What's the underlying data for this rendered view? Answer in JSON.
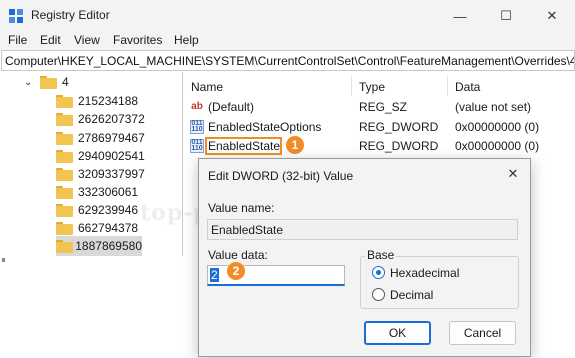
{
  "window": {
    "title": "Registry Editor",
    "minimize_glyph": "—",
    "maximize_glyph": "☐",
    "close_glyph": "✕"
  },
  "menu": [
    "File",
    "Edit",
    "View",
    "Favorites",
    "Help"
  ],
  "address": "Computer\\HKEY_LOCAL_MACHINE\\SYSTEM\\CurrentControlSet\\Control\\FeatureManagement\\Overrides\\4",
  "tree": {
    "parent_label": "4",
    "items": [
      "215234188",
      "2626207372",
      "2786979467",
      "2940902541",
      "3209337997",
      "332306061",
      "629239946",
      "662794378",
      "1887869580"
    ],
    "selected_index": 8
  },
  "values_pane": {
    "columns": [
      "Name",
      "Type",
      "Data"
    ],
    "rows": [
      {
        "name": "(Default)",
        "type": "REG_SZ",
        "data": "(value not set)",
        "icon": "string-value-icon"
      },
      {
        "name": "EnabledStateOptions",
        "type": "REG_DWORD",
        "data": "0x00000000 (0)",
        "icon": "binary-value-icon"
      },
      {
        "name": "EnabledState",
        "type": "REG_DWORD",
        "data": "0x00000000 (0)",
        "icon": "binary-value-icon"
      }
    ]
  },
  "annotations": {
    "step1": "1",
    "step2": "2"
  },
  "watermark": "top-password.com",
  "dialog": {
    "title": "Edit DWORD (32-bit) Value",
    "close_glyph": "✕",
    "value_name_label": "Value name:",
    "value_name": "EnabledState",
    "value_data_label": "Value data:",
    "value_data": "2",
    "base_label": "Base",
    "base_options": [
      "Hexadecimal",
      "Decimal"
    ],
    "base_selected": "Hexadecimal",
    "ok_label": "OK",
    "cancel_label": "Cancel"
  },
  "colors": {
    "accent": "#1a6ed8",
    "annotation": "#f28c28",
    "folder": "#f2c451"
  }
}
